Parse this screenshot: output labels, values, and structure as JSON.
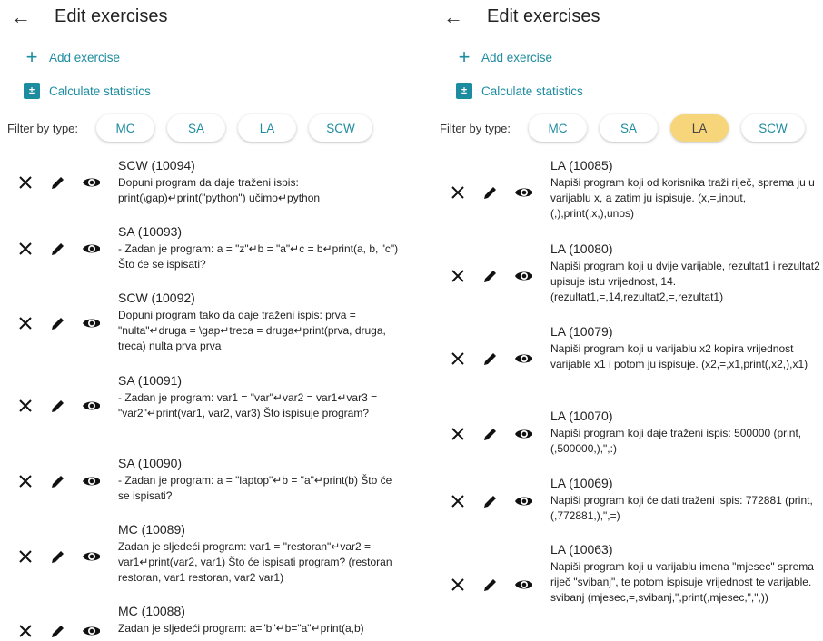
{
  "left": {
    "title": "Edit exercises",
    "add_label": "Add exercise",
    "stats_label": "Calculate statistics",
    "filter_label": "Filter by type:",
    "chips": [
      "MC",
      "SA",
      "LA",
      "SCW"
    ],
    "active_chip": null,
    "items": [
      {
        "title": "SCW (10094)",
        "desc": "Dopuni program da daje traženi ispis: print(\\gap)↵print(\"python\") učimo↵python"
      },
      {
        "title": "SA (10093)",
        "desc": " - Zadan je program: a = \"z\"↵b = \"a\"↵c = b↵print(a, b, \"c\")  Što će se ispisati?"
      },
      {
        "title": "SCW (10092)",
        "desc": "Dopuni program tako da daje traženi ispis: prva = \"nulta\"↵druga = \\gap↵treca = druga↵print(prva, druga, treca) nulta prva prva"
      },
      {
        "title": "SA (10091)",
        "desc": " - Zadan je program: var1 = \"var\"↵var2 = var1↵var3 = \"var2\"↵print(var1, var2, var3)  Što ispisuje program?"
      },
      {
        "title": "SA (10090)",
        "desc": " - Zadan je program: a = \"laptop\"↵b = \"a\"↵print(b) Što će se ispisati?"
      },
      {
        "title": "MC (10089)",
        "desc": "Zadan je sljedeći program: var1 = \"restoran\"↵var2 = var1↵print(var2, var1)  Što će ispisati program? (restoran restoran, var1 restoran, var2 var1)"
      },
      {
        "title": "MC (10088)",
        "desc": "Zadan je sljedeći program: a=\"b\"↵b=\"a\"↵print(a,b)"
      }
    ]
  },
  "right": {
    "title": "Edit exercises",
    "add_label": "Add exercise",
    "stats_label": "Calculate statistics",
    "filter_label": "Filter by type:",
    "chips": [
      "MC",
      "SA",
      "LA",
      "SCW"
    ],
    "active_chip": "LA",
    "items": [
      {
        "title": "LA (10085)",
        "desc": "Napiši program koji od korisnika traži riječ, sprema ju u varijablu x, a zatim ju ispisuje.  (x,=,input,(,),print(,x,),unos)"
      },
      {
        "title": "LA (10080)",
        "desc": "Napiši program koji u dvije varijable, rezultat1 i rezultat2 upisuje istu vrijednost, 14. (rezultat1,=,14,rezultat2,=,rezultat1)"
      },
      {
        "title": "LA (10079)",
        "desc": "Napiši program koji u varijablu x2 kopira vrijednost varijable x1 i potom ju ispisuje. (x2,=,x1,print(,x2,),x1)"
      },
      {
        "title": "LA (10070)",
        "desc": "Napiši program koji daje traženi ispis: 500000 (print,(,500000,),\",:)"
      },
      {
        "title": "LA (10069)",
        "desc": "Napiši program koji će dati traženi ispis: 772881 (print,(,772881,),\",=)"
      },
      {
        "title": "LA (10063)",
        "desc": "Napiši program koji u varijablu imena \"mjesec\" sprema riječ \"svibanj\", te potom ispisuje vrijednost te varijable. svibanj (mjesec,=,svibanj,\",print(,mjesec,\",\",))"
      }
    ]
  },
  "colors": {
    "accent": "#1e8ca0",
    "active_chip": "#f7d57a"
  },
  "icons": [
    "back-arrow-icon",
    "plus-icon",
    "calculator-icon",
    "close-icon",
    "pencil-icon",
    "eye-icon"
  ]
}
